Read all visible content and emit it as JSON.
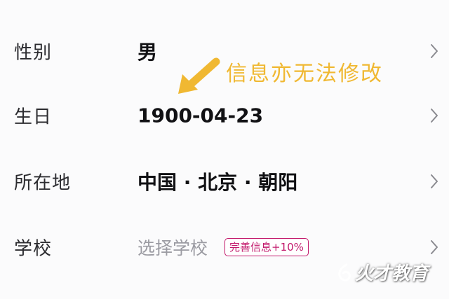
{
  "profile": {
    "rows": [
      {
        "label": "性别",
        "value": "男"
      },
      {
        "label": "生日",
        "value": "1900-04-23"
      },
      {
        "label": "所在地",
        "value": "中国 · 北京 · 朝阳"
      },
      {
        "label": "学校",
        "placeholder": "选择学校",
        "badge": "完善信息+10%"
      }
    ]
  },
  "annotation": {
    "text": "信息亦无法修改",
    "color": "#f0b832"
  },
  "watermark": {
    "text": "火才教育"
  },
  "icons": {
    "chevron": "chevron-right-icon",
    "arrow": "annotation-arrow-icon"
  },
  "colors": {
    "background": "#fbfbfc",
    "label": "#2c2c30",
    "value": "#111114",
    "placeholder": "#9b9ba2",
    "badge": "#c2186b",
    "chevron": "#8a8a90"
  }
}
